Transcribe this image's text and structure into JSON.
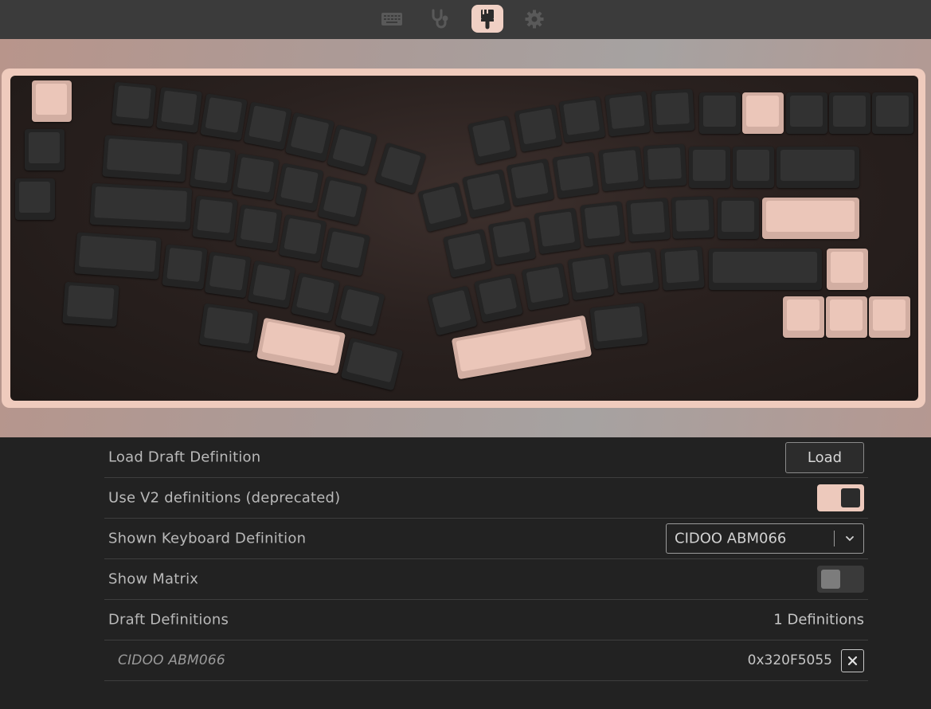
{
  "nav": {
    "items": [
      {
        "id": "configure",
        "icon": "keyboard-icon",
        "active": false
      },
      {
        "id": "test",
        "icon": "stethoscope-icon",
        "active": false
      },
      {
        "id": "design",
        "icon": "paintbrush-icon",
        "active": true
      },
      {
        "id": "settings",
        "icon": "gear-icon",
        "active": false
      }
    ]
  },
  "colors": {
    "accent": "#efcbbd",
    "background": "#222222",
    "topbar": "#3b3b3b",
    "key_dark": "#323232",
    "key_accent": "#ebc6b9"
  },
  "settings": {
    "load_draft": {
      "label": "Load Draft Definition",
      "button": "Load"
    },
    "use_v2": {
      "label": "Use V2 definitions (deprecated)",
      "enabled": true
    },
    "shown_definition": {
      "label": "Shown Keyboard Definition",
      "value": "CIDOO ABM066"
    },
    "show_matrix": {
      "label": "Show Matrix",
      "enabled": false
    },
    "draft_definitions": {
      "label": "Draft Definitions",
      "count_text": "1 Definitions"
    },
    "definitions": [
      {
        "name": "CIDOO ABM066",
        "id": "0x320F5055"
      }
    ]
  }
}
